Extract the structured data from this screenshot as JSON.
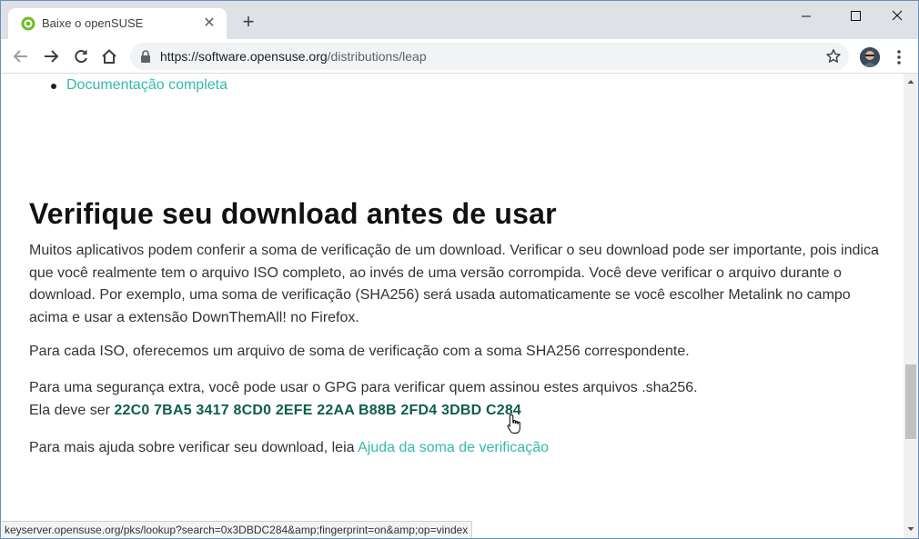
{
  "browser": {
    "tab": {
      "title": "Baixe o openSUSE",
      "favicon": "opensuse-icon"
    },
    "address": {
      "protocol_host": "https://software.opensuse.org",
      "path": "/distributions/leap"
    },
    "status_url": "keyserver.opensuse.org/pks/lookup?search=0x3DBDC284&amp;fingerprint=on&amp;op=vindex"
  },
  "page": {
    "doc_link": "Documentação completa",
    "heading": "Verifique seu download antes de usar",
    "para1": "Muitos aplicativos podem conferir a soma de verificação de um download. Verificar o seu download pode ser importante, pois indica que você realmente tem o arquivo ISO completo, ao invés de uma versão corrompida. Você deve verificar o arquivo durante o download. Por exemplo, uma soma de verificação (SHA256) será usada automaticamente se você escolher Metalink no campo acima e usar a extensão DownThemAll! no Firefox.",
    "para2": "Para cada ISO, oferecemos um arquivo de soma de verificação com a soma SHA256 correspondente.",
    "para3_line1": "Para uma segurança extra, você pode usar o GPG para verificar quem assinou estes arquivos .sha256.",
    "para3_prefix": "Ela deve ser",
    "fingerprint": "22C0 7BA5 3417 8CD0 2EFE 22AA B88B 2FD4 3DBD C284",
    "para4_prefix": "Para mais ajuda sobre verificar seu download, leia",
    "help_link": "Ajuda da soma de verificação"
  },
  "colors": {
    "link": "#35b9ab",
    "fingerprint": "#0d5e4a",
    "tabstrip": "#dee1e6"
  }
}
